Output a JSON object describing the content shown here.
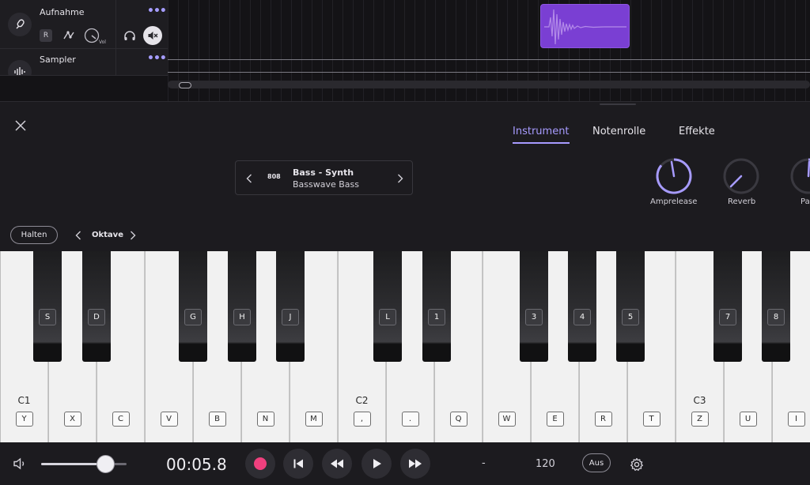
{
  "tracks": [
    {
      "name": "Aufnahme",
      "icon": "microphone-icon",
      "rec_label": "R",
      "vol_label": "Vol"
    },
    {
      "name": "Sampler",
      "icon": "waveform-icon"
    }
  ],
  "tabs": {
    "instrument": "Instrument",
    "piano_roll": "Notenrolle",
    "effects": "Effekte",
    "active": "instrument"
  },
  "preset": {
    "code": "808",
    "name": "Bass - Synth",
    "variant": "Basswave Bass"
  },
  "knobs": {
    "amp_release": "Amprelease",
    "reverb": "Reverb",
    "partial": "Pa"
  },
  "controls": {
    "hold_label": "Halten",
    "octave_label": "Oktave"
  },
  "keyboard": {
    "white_keys": [
      "Y",
      "X",
      "C",
      "V",
      "B",
      "N",
      "M",
      ",",
      ".",
      "Q",
      "W",
      "E",
      "R",
      "T",
      "Z",
      "U",
      "I"
    ],
    "black_keys": [
      "S",
      "D",
      "G",
      "H",
      "J",
      "L",
      "1",
      "3",
      "4",
      "5",
      "7",
      "8"
    ],
    "octaves": [
      "C1",
      "C2",
      "C3"
    ]
  },
  "transport": {
    "time": "00:05.8",
    "position_readout": "-",
    "tempo": "120",
    "metronome_label": "Aus",
    "volume_level": 0.75
  },
  "colors": {
    "accent": "#a79bff",
    "record": "#f0407e",
    "clip": "#7a3fd3"
  }
}
